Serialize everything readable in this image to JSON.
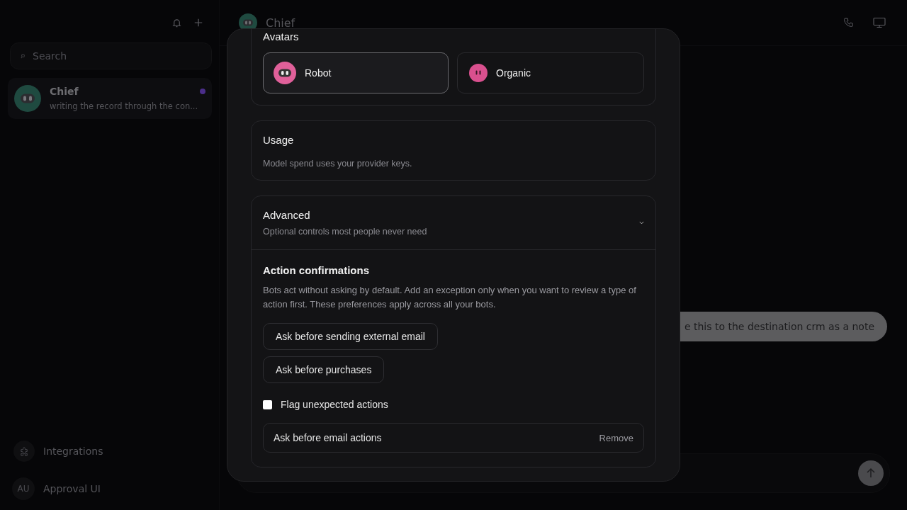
{
  "sidebar": {
    "search": {
      "placeholder": "Search"
    },
    "chats": [
      {
        "name": "Chief",
        "preview": "writing the record through the con...",
        "unread": true,
        "color": "#4b2e8a"
      }
    ],
    "footer": [
      {
        "kind": "integrations",
        "label": "Integrations"
      },
      {
        "kind": "user",
        "initials": "AU",
        "label": "Approval UI"
      }
    ]
  },
  "header": {
    "title": "Chief"
  },
  "messages": [
    {
      "text": "e this to the destination crm as a note"
    }
  ],
  "modal": {
    "avatars": {
      "title": "Avatars",
      "options": [
        {
          "label": "Robot",
          "kind": "robot",
          "selected": true
        },
        {
          "label": "Organic",
          "kind": "organic",
          "selected": false
        }
      ]
    },
    "usage": {
      "title": "Usage",
      "description": "Model spend uses your provider keys."
    },
    "advanced": {
      "title": "Advanced",
      "subtitle": "Optional controls most people never need",
      "expanded": true,
      "section_title": "Action confirmations",
      "description": "Bots act without asking by default. Add an exception only when you want to review a type of action first. These preferences apply across all your bots.",
      "suggestions": [
        "Ask before sending external email",
        "Ask before purchases"
      ],
      "flag": {
        "label": "Flag unexpected actions",
        "checked": false
      },
      "rules": [
        {
          "label": "Ask before email actions",
          "action": "Remove"
        }
      ]
    }
  }
}
